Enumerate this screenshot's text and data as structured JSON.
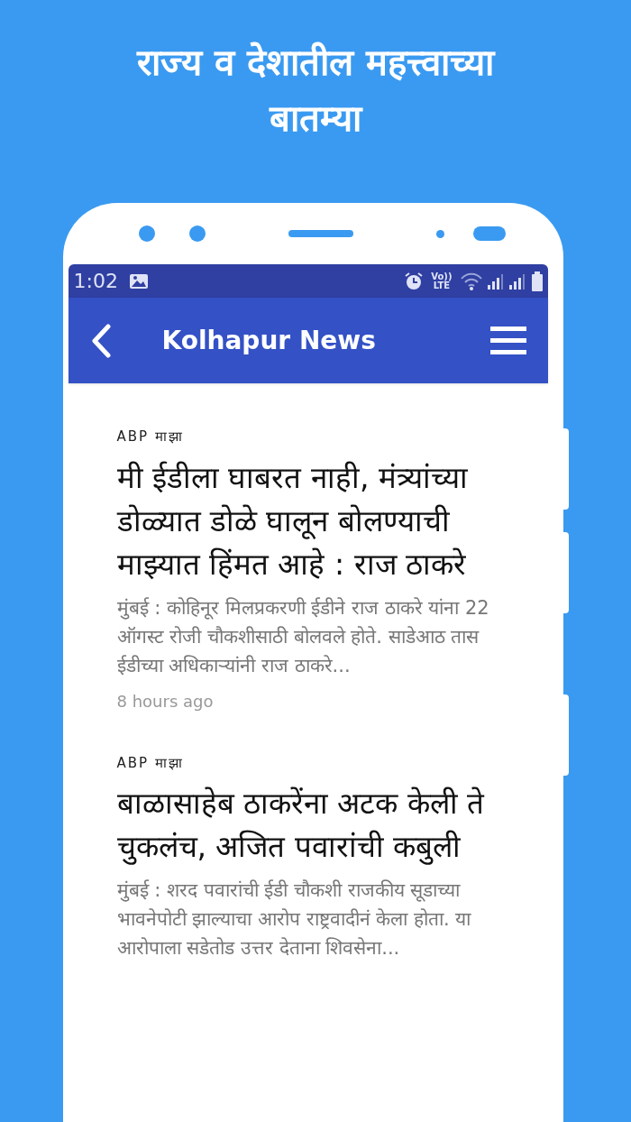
{
  "promo_heading": "राज्य व देशातील महत्त्वाच्या बातम्या",
  "status_bar": {
    "time": "1:02",
    "volte": "Vo))",
    "lte": "LTE"
  },
  "app_bar": {
    "title": "Kolhapur News"
  },
  "articles": [
    {
      "source": "ABP माझा",
      "headline": "मी ईडीला घाबरत नाही, मंत्र्यांच्या डोळ्यात डोळे घालून बोलण्याची माझ्यात हिंमत आहे : राज ठाकरे",
      "summary": "मुंबई : कोहिनूर मिलप्रकरणी ईडीने राज ठाकरे यांना 22 ऑगस्ट रोजी चौकशीसाठी बोलवले होते. साडेआठ तास ईडीच्या अधिकाऱ्यांनी राज ठाकरे...",
      "time": "8 hours ago"
    },
    {
      "source": "ABP माझा",
      "headline": "बाळासाहेब ठाकरेंना अटक केली ते चुकलंच, अजित पवारांची कबुली",
      "summary": "मुंबई : शरद पवारांची ईडी चौकशी राजकीय सूडाच्या भावनेपोटी झाल्याचा आरोप राष्ट्रवादीनं केला होता. या आरोपाला सडेतोड उत्तर देताना शिवसेना..."
    }
  ]
}
